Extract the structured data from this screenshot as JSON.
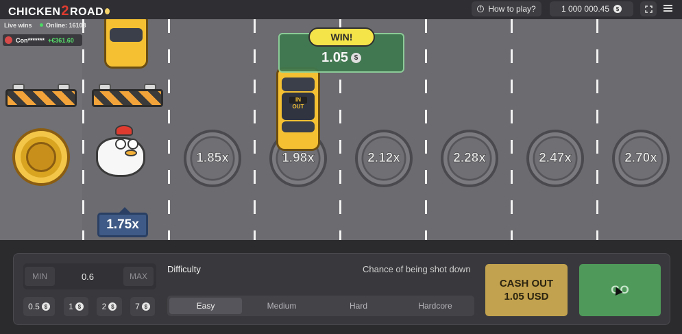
{
  "header": {
    "logo": {
      "part1": "CHICKEN",
      "part2": "2",
      "part3": "ROAD"
    },
    "how_to_play": "How to play?",
    "balance": "1 000 000.45",
    "currency_symbol": "$"
  },
  "live": {
    "label": "Live wins",
    "online": "Online: 16103",
    "recent_win": {
      "user": "Con*******",
      "amount": "+€361.60"
    }
  },
  "road": {
    "current_multiplier": "1.75x",
    "multipliers": [
      "1.85x",
      "1.98x",
      "2.12x",
      "2.28x",
      "2.47x",
      "2.70x"
    ],
    "car_sign": "IN OUT",
    "win": {
      "label": "WIN!",
      "amount": "1.05",
      "currency_symbol": "$"
    }
  },
  "controls": {
    "min_label": "MIN",
    "max_label": "MAX",
    "bet_value": "0.6",
    "chips": [
      "0.5",
      "1",
      "2",
      "7"
    ],
    "chip_currency": "$",
    "difficulty_label": "Difficulty",
    "chance_label": "Chance of being shot down",
    "difficulties": [
      "Easy",
      "Medium",
      "Hard",
      "Hardcore"
    ],
    "selected_difficulty": "Easy",
    "cashout": {
      "line1": "CASH OUT",
      "line2": "1.05 USD"
    },
    "go_label": "GO"
  }
}
